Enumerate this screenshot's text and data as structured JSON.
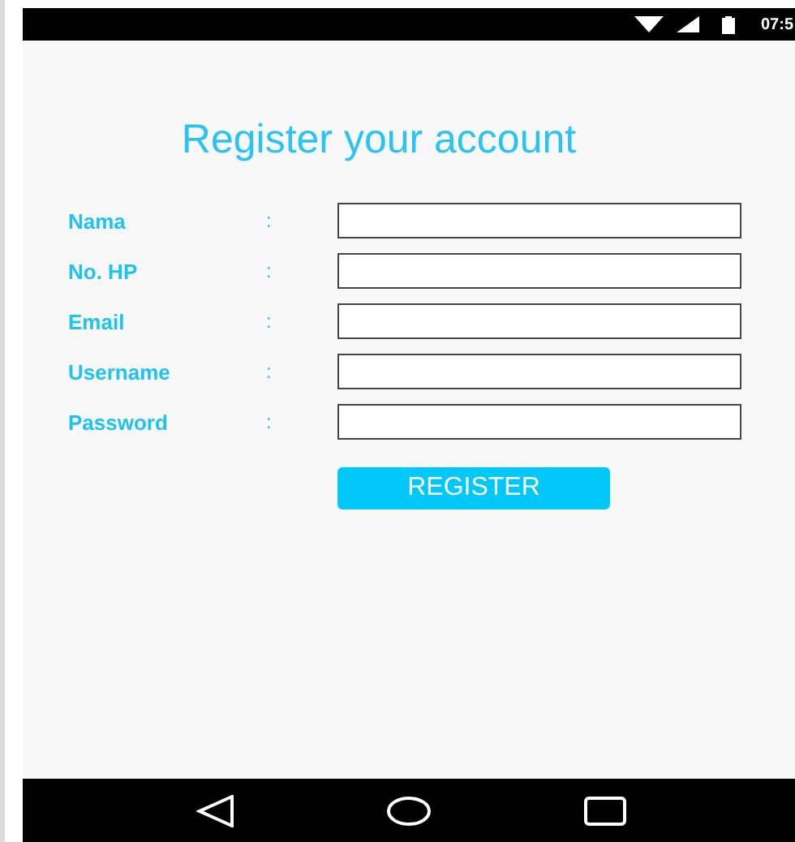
{
  "status_bar": {
    "time": "07:5"
  },
  "title": "Register your account",
  "fields": [
    {
      "label": "Nama",
      "separator": ":"
    },
    {
      "label": "No. HP",
      "separator": ":"
    },
    {
      "label": "Email",
      "separator": ":"
    },
    {
      "label": "Username",
      "separator": ":"
    },
    {
      "label": "Password",
      "separator": ":"
    }
  ],
  "button": "REGISTER"
}
